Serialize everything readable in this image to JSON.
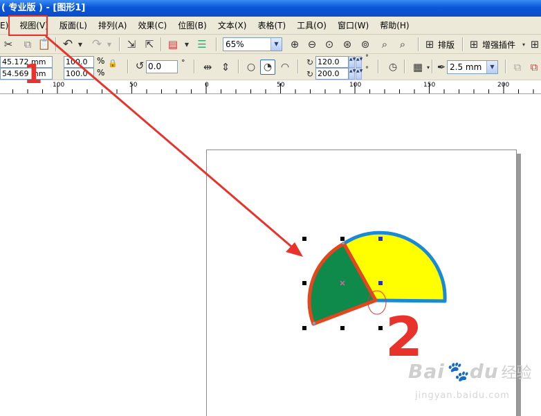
{
  "window": {
    "title": "( 专业版 ) - [图形1]"
  },
  "menu": {
    "items": [
      {
        "label": "E)"
      },
      {
        "label": "视图(V)"
      },
      {
        "label": "版面(L)"
      },
      {
        "label": "排列(A)"
      },
      {
        "label": "效果(C)"
      },
      {
        "label": "位图(B)"
      },
      {
        "label": "文本(X)"
      },
      {
        "label": "表格(T)"
      },
      {
        "label": "工具(O)"
      },
      {
        "label": "窗口(W)"
      },
      {
        "label": "帮助(H)"
      }
    ]
  },
  "toolbar": {
    "zoom_value": "65%",
    "layout_label": "排版",
    "plugin_label": "增强插件"
  },
  "property_bar": {
    "x_value": "45.172 mm",
    "y_value": "54.569 mm",
    "scale_w": "100.0",
    "scale_h": "100.0",
    "percent": "%",
    "rotation": "0.0",
    "degree": "°",
    "start_angle": "120.0",
    "end_angle": "200.0",
    "outline_width": "2.5 mm"
  },
  "ruler": {
    "labels": [
      "100",
      "50",
      "0",
      "50",
      "100",
      "150",
      "200"
    ]
  },
  "annotations": {
    "step1": "1",
    "step2": "2"
  },
  "watermark": {
    "brand": "Bai",
    "brand2": "du",
    "cn": "经验",
    "url": "jingyan.baidu.com"
  },
  "colors": {
    "green_fill": "#0f8a4a",
    "yellow_fill": "#ffff00",
    "orange_outline": "#e5461b",
    "blue_outline": "#1a8ad6",
    "annotation_red": "#e8332c"
  }
}
